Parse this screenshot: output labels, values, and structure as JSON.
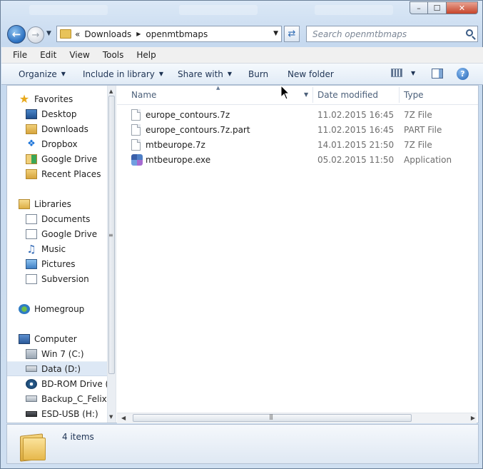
{
  "window": {
    "caption_buttons": {
      "minimize": "–",
      "maximize": "☐",
      "close": "✕"
    }
  },
  "nav": {
    "back_icon": "back-arrow-icon",
    "forward_icon": "forward-arrow-icon",
    "history_caret": "▼",
    "address_prefix": "«",
    "breadcrumbs": [
      "Downloads",
      "openmtbmaps"
    ],
    "search_placeholder": "Search openmtbmaps"
  },
  "menubar": {
    "items": [
      "File",
      "Edit",
      "View",
      "Tools",
      "Help"
    ]
  },
  "toolbar": {
    "organize": "Organize",
    "include_in_library": "Include in library",
    "share_with": "Share with",
    "burn": "Burn",
    "new_folder": "New folder"
  },
  "navpane": {
    "favorites": {
      "header": "Favorites",
      "items": [
        "Desktop",
        "Downloads",
        "Dropbox",
        "Google Drive",
        "Recent Places"
      ]
    },
    "libraries": {
      "header": "Libraries",
      "items": [
        "Documents",
        "Google Drive",
        "Music",
        "Pictures",
        "Subversion"
      ]
    },
    "homegroup": "Homegroup",
    "computer": {
      "header": "Computer",
      "items": [
        "Win 7 (C:)",
        "Data (D:)",
        "BD-ROM Drive (F",
        "Backup_C_Felix (",
        "ESD-USB (H:)"
      ],
      "selected": "Data (D:)"
    }
  },
  "columns": {
    "name": "Name",
    "date_modified": "Date modified",
    "type": "Type"
  },
  "files": [
    {
      "name": "europe_contours.7z",
      "date": "11.02.2015 16:45",
      "type": "7Z File",
      "icon": "file-icon"
    },
    {
      "name": "europe_contours.7z.part",
      "date": "11.02.2015 16:45",
      "type": "PART File",
      "icon": "file-icon"
    },
    {
      "name": "mtbeurope.7z",
      "date": "14.01.2015 21:50",
      "type": "7Z File",
      "icon": "file-icon"
    },
    {
      "name": "mtbeurope.exe",
      "date": "05.02.2015 11:50",
      "type": "Application",
      "icon": "application-icon"
    }
  ],
  "status": {
    "item_count": "4 items"
  }
}
